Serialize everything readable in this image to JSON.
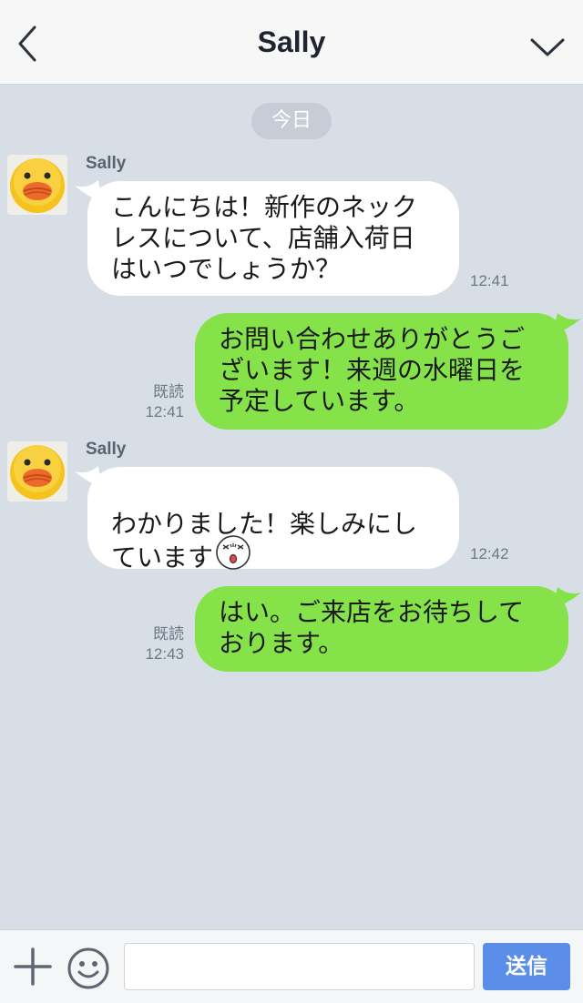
{
  "header": {
    "title": "Sally",
    "back_icon": "chevron-left-icon",
    "menu_icon": "chevron-down-icon"
  },
  "date_label": "今日",
  "messages": [
    {
      "direction": "incoming",
      "sender": "Sally",
      "text": "こんにちは！新作のネック\nレスについて、店舗入荷日\nはいつでしょうか？",
      "time": "12:41"
    },
    {
      "direction": "outgoing",
      "read_label": "既読",
      "text": "お問い合わせありがとうご\nざいます！来週の水曜日を\n予定しています。",
      "time": "12:41"
    },
    {
      "direction": "incoming",
      "sender": "Sally",
      "text": "わかりました！楽しみにし\nています",
      "emoji": "surprised-face-sticker-icon",
      "time": "12:42"
    },
    {
      "direction": "outgoing",
      "read_label": "既読",
      "text": "はい。ご来店をお待ちして\nおります。",
      "time": "12:43"
    }
  ],
  "input_bar": {
    "plus_icon": "plus-icon",
    "emoji_icon": "smiley-icon",
    "input_value": "",
    "send_label": "送信"
  },
  "colors": {
    "background": "#d8dee6",
    "incoming_bubble": "#ffffff",
    "outgoing_bubble": "#85e249",
    "send_button": "#5a8ee8"
  }
}
